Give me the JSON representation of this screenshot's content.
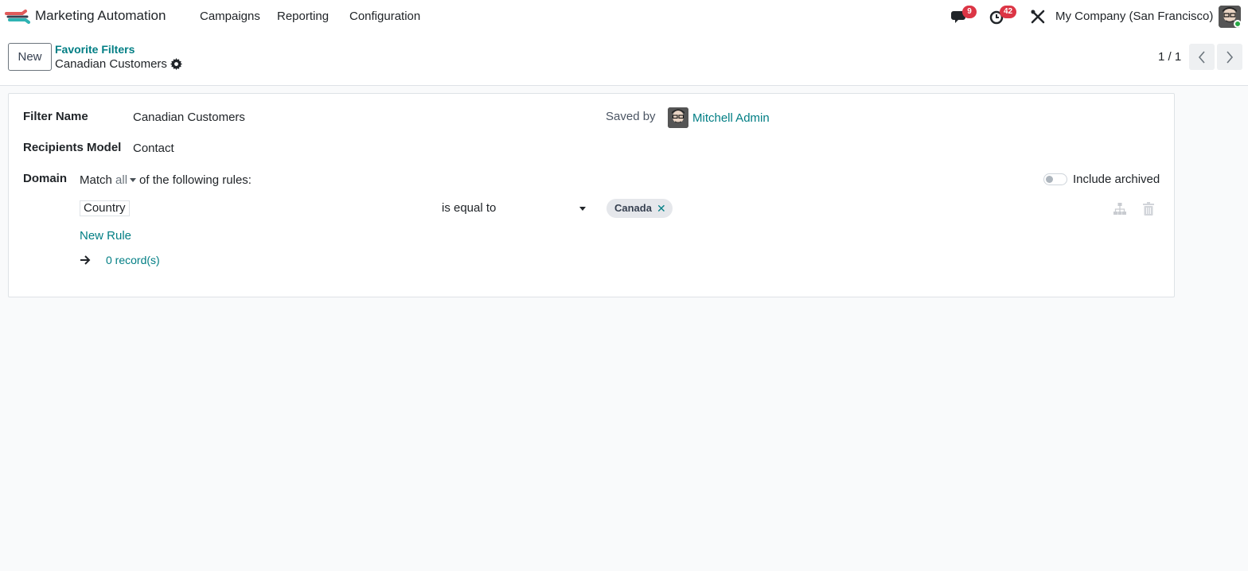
{
  "navbar": {
    "app_name": "Marketing Automation",
    "menus": [
      "Campaigns",
      "Reporting",
      "Configuration"
    ],
    "messages_count": "9",
    "activities_count": "42",
    "company": "My Company (San Francisco)"
  },
  "control_panel": {
    "new_label": "New",
    "breadcrumb_parent": "Favorite Filters",
    "breadcrumb_current": "Canadian Customers",
    "pager": "1 / 1"
  },
  "form": {
    "filter_name_label": "Filter Name",
    "filter_name_value": "Canadian Customers",
    "saved_by_label": "Saved by",
    "saved_by_user": "Mitchell Admin",
    "model_label": "Recipients Model",
    "model_value": "Contact",
    "domain_label": "Domain",
    "match_prefix": "Match",
    "match_mode": "all",
    "match_suffix": "of the following rules:",
    "include_archived_label": "Include archived",
    "rule": {
      "field": "Country",
      "operator": "is equal to",
      "value_tag": "Canada"
    },
    "new_rule_label": "New Rule",
    "records_label": "0 record(s)"
  },
  "colors": {
    "accent": "#017e84",
    "badge": "#dc3545",
    "online": "#28a745"
  },
  "icons": [
    "app-logo",
    "chat-icon",
    "clock-icon",
    "tools-icon",
    "gear-icon",
    "chevron-left-icon",
    "chevron-right-icon",
    "hierarchy-icon",
    "trash-icon",
    "arrow-right-icon"
  ]
}
